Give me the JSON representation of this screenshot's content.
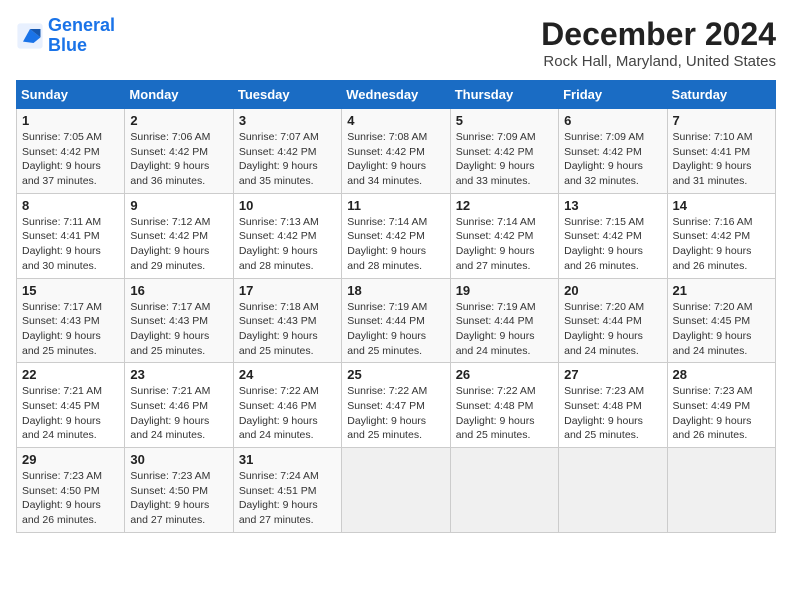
{
  "logo": {
    "line1": "General",
    "line2": "Blue"
  },
  "title": "December 2024",
  "subtitle": "Rock Hall, Maryland, United States",
  "headers": [
    "Sunday",
    "Monday",
    "Tuesday",
    "Wednesday",
    "Thursday",
    "Friday",
    "Saturday"
  ],
  "weeks": [
    [
      {
        "day": "1",
        "sunrise": "Sunrise: 7:05 AM",
        "sunset": "Sunset: 4:42 PM",
        "daylight": "Daylight: 9 hours and 37 minutes."
      },
      {
        "day": "2",
        "sunrise": "Sunrise: 7:06 AM",
        "sunset": "Sunset: 4:42 PM",
        "daylight": "Daylight: 9 hours and 36 minutes."
      },
      {
        "day": "3",
        "sunrise": "Sunrise: 7:07 AM",
        "sunset": "Sunset: 4:42 PM",
        "daylight": "Daylight: 9 hours and 35 minutes."
      },
      {
        "day": "4",
        "sunrise": "Sunrise: 7:08 AM",
        "sunset": "Sunset: 4:42 PM",
        "daylight": "Daylight: 9 hours and 34 minutes."
      },
      {
        "day": "5",
        "sunrise": "Sunrise: 7:09 AM",
        "sunset": "Sunset: 4:42 PM",
        "daylight": "Daylight: 9 hours and 33 minutes."
      },
      {
        "day": "6",
        "sunrise": "Sunrise: 7:09 AM",
        "sunset": "Sunset: 4:42 PM",
        "daylight": "Daylight: 9 hours and 32 minutes."
      },
      {
        "day": "7",
        "sunrise": "Sunrise: 7:10 AM",
        "sunset": "Sunset: 4:41 PM",
        "daylight": "Daylight: 9 hours and 31 minutes."
      }
    ],
    [
      {
        "day": "8",
        "sunrise": "Sunrise: 7:11 AM",
        "sunset": "Sunset: 4:41 PM",
        "daylight": "Daylight: 9 hours and 30 minutes."
      },
      {
        "day": "9",
        "sunrise": "Sunrise: 7:12 AM",
        "sunset": "Sunset: 4:42 PM",
        "daylight": "Daylight: 9 hours and 29 minutes."
      },
      {
        "day": "10",
        "sunrise": "Sunrise: 7:13 AM",
        "sunset": "Sunset: 4:42 PM",
        "daylight": "Daylight: 9 hours and 28 minutes."
      },
      {
        "day": "11",
        "sunrise": "Sunrise: 7:14 AM",
        "sunset": "Sunset: 4:42 PM",
        "daylight": "Daylight: 9 hours and 28 minutes."
      },
      {
        "day": "12",
        "sunrise": "Sunrise: 7:14 AM",
        "sunset": "Sunset: 4:42 PM",
        "daylight": "Daylight: 9 hours and 27 minutes."
      },
      {
        "day": "13",
        "sunrise": "Sunrise: 7:15 AM",
        "sunset": "Sunset: 4:42 PM",
        "daylight": "Daylight: 9 hours and 26 minutes."
      },
      {
        "day": "14",
        "sunrise": "Sunrise: 7:16 AM",
        "sunset": "Sunset: 4:42 PM",
        "daylight": "Daylight: 9 hours and 26 minutes."
      }
    ],
    [
      {
        "day": "15",
        "sunrise": "Sunrise: 7:17 AM",
        "sunset": "Sunset: 4:43 PM",
        "daylight": "Daylight: 9 hours and 25 minutes."
      },
      {
        "day": "16",
        "sunrise": "Sunrise: 7:17 AM",
        "sunset": "Sunset: 4:43 PM",
        "daylight": "Daylight: 9 hours and 25 minutes."
      },
      {
        "day": "17",
        "sunrise": "Sunrise: 7:18 AM",
        "sunset": "Sunset: 4:43 PM",
        "daylight": "Daylight: 9 hours and 25 minutes."
      },
      {
        "day": "18",
        "sunrise": "Sunrise: 7:19 AM",
        "sunset": "Sunset: 4:44 PM",
        "daylight": "Daylight: 9 hours and 25 minutes."
      },
      {
        "day": "19",
        "sunrise": "Sunrise: 7:19 AM",
        "sunset": "Sunset: 4:44 PM",
        "daylight": "Daylight: 9 hours and 24 minutes."
      },
      {
        "day": "20",
        "sunrise": "Sunrise: 7:20 AM",
        "sunset": "Sunset: 4:44 PM",
        "daylight": "Daylight: 9 hours and 24 minutes."
      },
      {
        "day": "21",
        "sunrise": "Sunrise: 7:20 AM",
        "sunset": "Sunset: 4:45 PM",
        "daylight": "Daylight: 9 hours and 24 minutes."
      }
    ],
    [
      {
        "day": "22",
        "sunrise": "Sunrise: 7:21 AM",
        "sunset": "Sunset: 4:45 PM",
        "daylight": "Daylight: 9 hours and 24 minutes."
      },
      {
        "day": "23",
        "sunrise": "Sunrise: 7:21 AM",
        "sunset": "Sunset: 4:46 PM",
        "daylight": "Daylight: 9 hours and 24 minutes."
      },
      {
        "day": "24",
        "sunrise": "Sunrise: 7:22 AM",
        "sunset": "Sunset: 4:46 PM",
        "daylight": "Daylight: 9 hours and 24 minutes."
      },
      {
        "day": "25",
        "sunrise": "Sunrise: 7:22 AM",
        "sunset": "Sunset: 4:47 PM",
        "daylight": "Daylight: 9 hours and 25 minutes."
      },
      {
        "day": "26",
        "sunrise": "Sunrise: 7:22 AM",
        "sunset": "Sunset: 4:48 PM",
        "daylight": "Daylight: 9 hours and 25 minutes."
      },
      {
        "day": "27",
        "sunrise": "Sunrise: 7:23 AM",
        "sunset": "Sunset: 4:48 PM",
        "daylight": "Daylight: 9 hours and 25 minutes."
      },
      {
        "day": "28",
        "sunrise": "Sunrise: 7:23 AM",
        "sunset": "Sunset: 4:49 PM",
        "daylight": "Daylight: 9 hours and 26 minutes."
      }
    ],
    [
      {
        "day": "29",
        "sunrise": "Sunrise: 7:23 AM",
        "sunset": "Sunset: 4:50 PM",
        "daylight": "Daylight: 9 hours and 26 minutes."
      },
      {
        "day": "30",
        "sunrise": "Sunrise: 7:23 AM",
        "sunset": "Sunset: 4:50 PM",
        "daylight": "Daylight: 9 hours and 27 minutes."
      },
      {
        "day": "31",
        "sunrise": "Sunrise: 7:24 AM",
        "sunset": "Sunset: 4:51 PM",
        "daylight": "Daylight: 9 hours and 27 minutes."
      },
      null,
      null,
      null,
      null
    ]
  ]
}
